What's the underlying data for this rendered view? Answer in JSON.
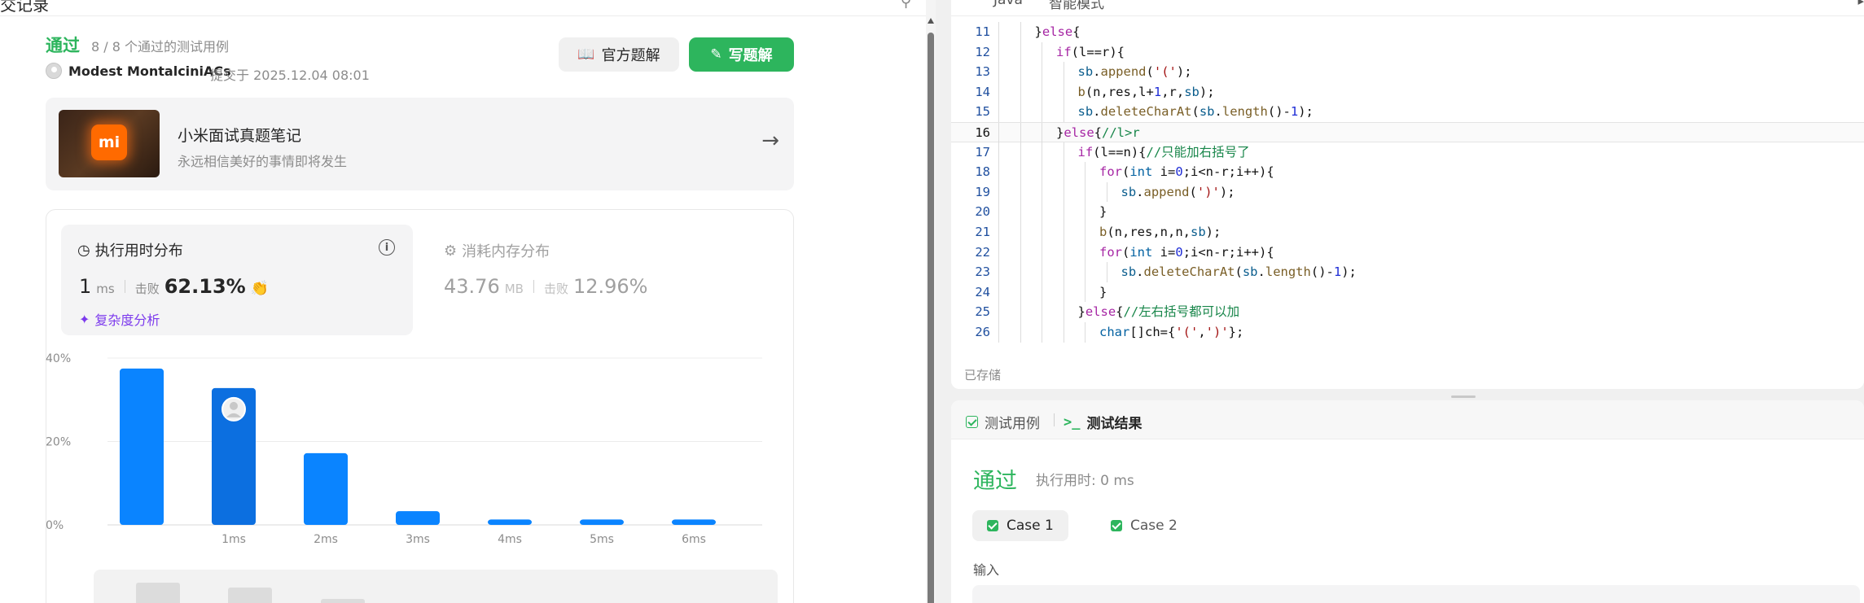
{
  "left": {
    "header_title": "交记录",
    "header_icon": "link-icon",
    "status": "通过",
    "status_sub": "8 / 8 个通过的测试用例",
    "user": "Modest MontalciniACs",
    "submit_time": "提交于 2025.12.04 08:01",
    "btn_official": "官方题解",
    "btn_write": "写题解",
    "banner": {
      "logo": "mi",
      "title": "小米面试真题笔记",
      "subtitle": "永远相信美好的事情即将发生"
    },
    "time": {
      "title": "执行用时分布",
      "value": "1",
      "unit": "ms",
      "beat_label": "击败",
      "beat": "62.13%",
      "complexity": "复杂度分析"
    },
    "memory": {
      "title": "消耗内存分布",
      "value": "43.76",
      "unit": "MB",
      "beat_label": "击败",
      "beat": "12.96%"
    }
  },
  "chart_data": {
    "type": "bar",
    "categories": [
      "",
      "1ms",
      "2ms",
      "3ms",
      "4ms",
      "5ms",
      "6ms"
    ],
    "values": [
      37.5,
      32.8,
      17.2,
      3.3,
      1.3,
      1.3,
      1.3
    ],
    "yticks": [
      "40%",
      "20%",
      "0%"
    ],
    "ylim": [
      0,
      40
    ],
    "highlight_index": 1,
    "bar_color": "#0a84ff",
    "highlight_color": "#0c6fe0",
    "grid": true
  },
  "editor": {
    "language": "Java",
    "mode": "智能模式",
    "saved": "已存储",
    "current_line": 16,
    "lines": [
      {
        "n": 11,
        "indent": 1,
        "code": "}else{"
      },
      {
        "n": 12,
        "indent": 2,
        "code": "if(l==r){"
      },
      {
        "n": 13,
        "indent": 3,
        "code": "sb.append('(');"
      },
      {
        "n": 14,
        "indent": 3,
        "code": "b(n,res,l+1,r,sb);"
      },
      {
        "n": 15,
        "indent": 3,
        "code": "sb.deleteCharAt(sb.length()-1);"
      },
      {
        "n": 16,
        "indent": 2,
        "code": "}else{//l>r"
      },
      {
        "n": 17,
        "indent": 3,
        "code": "if(l==n){//只能加右括号了"
      },
      {
        "n": 18,
        "indent": 4,
        "code": "for(int i=0;i<n-r;i++){"
      },
      {
        "n": 19,
        "indent": 5,
        "code": "sb.append(')');"
      },
      {
        "n": 20,
        "indent": 4,
        "code": "}"
      },
      {
        "n": 21,
        "indent": 4,
        "code": "b(n,res,n,n,sb);"
      },
      {
        "n": 22,
        "indent": 4,
        "code": "for(int i=0;i<n-r;i++){"
      },
      {
        "n": 23,
        "indent": 5,
        "code": "sb.deleteCharAt(sb.length()-1);"
      },
      {
        "n": 24,
        "indent": 4,
        "code": "}"
      },
      {
        "n": 25,
        "indent": 3,
        "code": "}else{//左右括号都可以加"
      },
      {
        "n": 26,
        "indent": 4,
        "code": "char[]ch={'(',')'};"
      }
    ]
  },
  "results": {
    "tab_cases": "测试用例",
    "tab_result": "测试结果",
    "status": "通过",
    "exec_time": "执行用时: 0 ms",
    "case1": "Case 1",
    "case2": "Case 2",
    "input_label": "输入"
  }
}
